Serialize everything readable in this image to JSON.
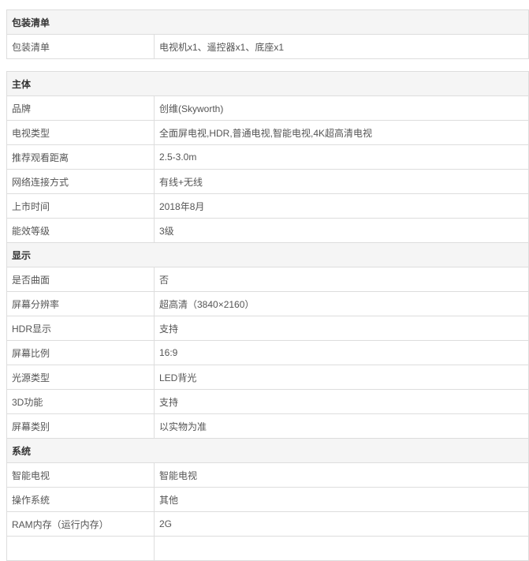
{
  "package": {
    "title": "包装清单",
    "rows": [
      {
        "key": "包装清单",
        "value": "电视机x1、遥控器x1、底座x1"
      }
    ]
  },
  "main": {
    "title": "主体",
    "rows": [
      {
        "key": "品牌",
        "value": "创维(Skyworth)"
      },
      {
        "key": "电视类型",
        "value": "全面屏电视,HDR,普通电视,智能电视,4K超高清电视"
      },
      {
        "key": "推荐观看距离",
        "value": "2.5-3.0m"
      },
      {
        "key": "网络连接方式",
        "value": "有线+无线"
      },
      {
        "key": "上市时间",
        "value": "2018年8月"
      },
      {
        "key": "能效等级",
        "value": "3级"
      }
    ]
  },
  "display": {
    "title": "显示",
    "rows": [
      {
        "key": "是否曲面",
        "value": "否"
      },
      {
        "key": "屏幕分辨率",
        "value": "超高清（3840×2160）"
      },
      {
        "key": "HDR显示",
        "value": "支持"
      },
      {
        "key": "屏幕比例",
        "value": "16:9"
      },
      {
        "key": "光源类型",
        "value": "LED背光"
      },
      {
        "key": "3D功能",
        "value": "支持"
      },
      {
        "key": "屏幕类别",
        "value": "以实物为准"
      }
    ]
  },
  "system": {
    "title": "系统",
    "rows": [
      {
        "key": "智能电视",
        "value": "智能电视"
      },
      {
        "key": "操作系统",
        "value": "其他"
      },
      {
        "key": "RAM内存（运行内存）",
        "value": "2G"
      },
      {
        "key": "",
        "value": ""
      }
    ]
  }
}
